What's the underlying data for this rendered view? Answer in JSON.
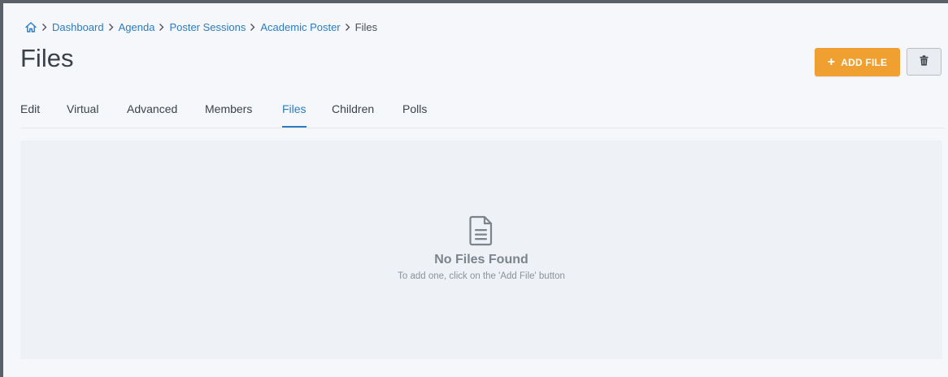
{
  "breadcrumb": {
    "home_icon": "home-icon",
    "items": [
      "Dashboard",
      "Agenda",
      "Poster Sessions",
      "Academic Poster"
    ],
    "current": "Files"
  },
  "page": {
    "title": "Files"
  },
  "toolbar": {
    "add_file_label": "ADD FILE",
    "add_file_icon": "plus-icon",
    "delete_icon": "trash-icon",
    "accent_color": "#f0a030"
  },
  "tabs": [
    {
      "label": "Edit"
    },
    {
      "label": "Virtual"
    },
    {
      "label": "Advanced"
    },
    {
      "label": "Members"
    },
    {
      "label": "Files",
      "active": true
    },
    {
      "label": "Children"
    },
    {
      "label": "Polls"
    }
  ],
  "empty_state": {
    "icon": "document-icon",
    "title": "No Files Found",
    "subtitle": "To add one, click on the 'Add File' button"
  },
  "colors": {
    "link": "#2b7cc1",
    "background": "#f5f7fa",
    "panel": "#eef1f5"
  }
}
